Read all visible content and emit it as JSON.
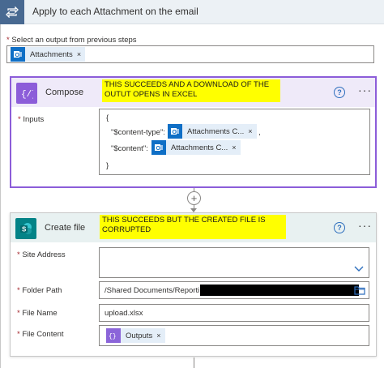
{
  "loop": {
    "title": "Apply to each Attachment on the email",
    "select_label_required": "*",
    "select_label": "Select an output from previous steps",
    "token": {
      "label": "Attachments",
      "close": "×"
    }
  },
  "compose": {
    "title": "Compose",
    "note": "THIS SUCCEEDS AND A DOWNLOAD OF THE OUTUT OPENS IN EXCEL",
    "help": "?",
    "more": "···",
    "inputs_label_required": "*",
    "inputs_label": "Inputs",
    "open_brace": "{",
    "content_type_key": "\"$content-type\":",
    "content_type_token": "Attachments C...",
    "content_type_suffix": ",",
    "content_key": "\"$content\":",
    "content_token": "Attachments C...",
    "close_brace": "}",
    "token_close": "×"
  },
  "create_file": {
    "title": "Create file",
    "note": "THIS SUCCEEDS BUT THE CREATED FILE IS CORRUPTED",
    "help": "?",
    "more": "···",
    "site_address": {
      "required": "*",
      "label": "Site Address",
      "value": ""
    },
    "folder_path": {
      "required": "*",
      "label": "Folder Path",
      "value": "/Shared Documents/Reporti"
    },
    "file_name": {
      "required": "*",
      "label": "File Name",
      "value": "upload.xlsx"
    },
    "file_content": {
      "required": "*",
      "label": "File Content",
      "token": "Outputs",
      "token_close": "×"
    }
  },
  "connector": {
    "add_symbol": "+"
  },
  "colors": {
    "loop_icon": "#486991",
    "outlook_blue": "#0f6fc6",
    "compose_purple": "#8c5dd9",
    "sharepoint_teal": "#038387",
    "note_yellow": "#ffff00",
    "required_red": "#a4262c"
  },
  "icons": {
    "loop": "loop-arrows-icon",
    "outlook": "outlook-icon",
    "compose": "curly-braces-icon",
    "sharepoint": "sharepoint-icon",
    "help": "help-circle-icon",
    "more": "more-ellipsis-icon",
    "chevron": "chevron-down-icon",
    "folder": "folder-icon"
  }
}
